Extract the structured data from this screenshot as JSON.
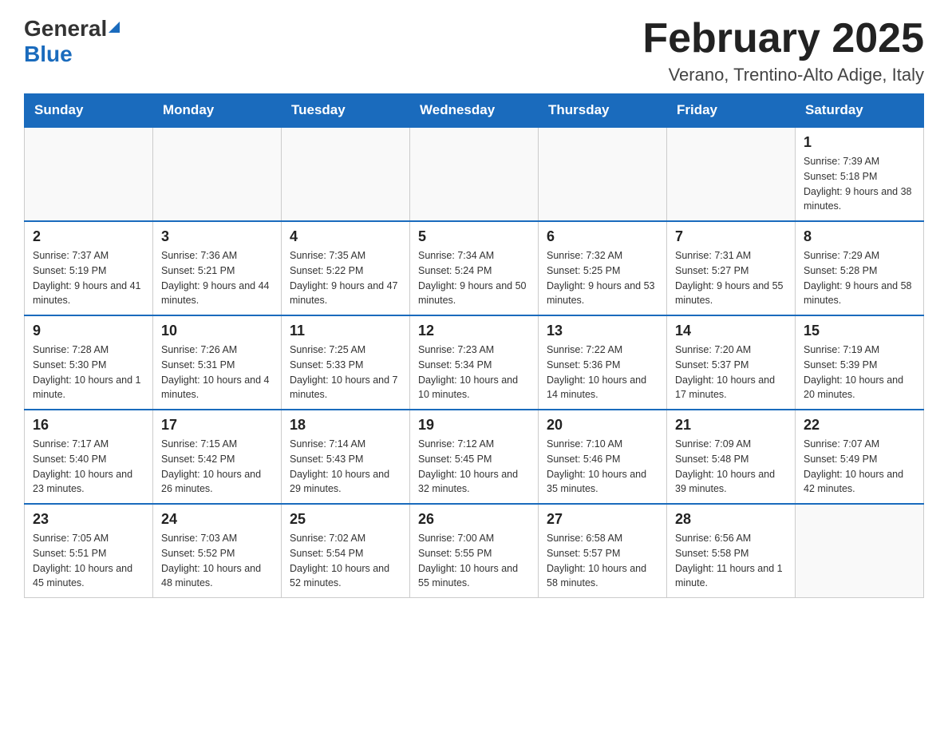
{
  "header": {
    "logo_general": "General",
    "logo_blue": "Blue",
    "month_title": "February 2025",
    "location": "Verano, Trentino-Alto Adige, Italy"
  },
  "days_of_week": [
    "Sunday",
    "Monday",
    "Tuesday",
    "Wednesday",
    "Thursday",
    "Friday",
    "Saturday"
  ],
  "weeks": [
    [
      {
        "day": "",
        "info": ""
      },
      {
        "day": "",
        "info": ""
      },
      {
        "day": "",
        "info": ""
      },
      {
        "day": "",
        "info": ""
      },
      {
        "day": "",
        "info": ""
      },
      {
        "day": "",
        "info": ""
      },
      {
        "day": "1",
        "info": "Sunrise: 7:39 AM\nSunset: 5:18 PM\nDaylight: 9 hours and 38 minutes."
      }
    ],
    [
      {
        "day": "2",
        "info": "Sunrise: 7:37 AM\nSunset: 5:19 PM\nDaylight: 9 hours and 41 minutes."
      },
      {
        "day": "3",
        "info": "Sunrise: 7:36 AM\nSunset: 5:21 PM\nDaylight: 9 hours and 44 minutes."
      },
      {
        "day": "4",
        "info": "Sunrise: 7:35 AM\nSunset: 5:22 PM\nDaylight: 9 hours and 47 minutes."
      },
      {
        "day": "5",
        "info": "Sunrise: 7:34 AM\nSunset: 5:24 PM\nDaylight: 9 hours and 50 minutes."
      },
      {
        "day": "6",
        "info": "Sunrise: 7:32 AM\nSunset: 5:25 PM\nDaylight: 9 hours and 53 minutes."
      },
      {
        "day": "7",
        "info": "Sunrise: 7:31 AM\nSunset: 5:27 PM\nDaylight: 9 hours and 55 minutes."
      },
      {
        "day": "8",
        "info": "Sunrise: 7:29 AM\nSunset: 5:28 PM\nDaylight: 9 hours and 58 minutes."
      }
    ],
    [
      {
        "day": "9",
        "info": "Sunrise: 7:28 AM\nSunset: 5:30 PM\nDaylight: 10 hours and 1 minute."
      },
      {
        "day": "10",
        "info": "Sunrise: 7:26 AM\nSunset: 5:31 PM\nDaylight: 10 hours and 4 minutes."
      },
      {
        "day": "11",
        "info": "Sunrise: 7:25 AM\nSunset: 5:33 PM\nDaylight: 10 hours and 7 minutes."
      },
      {
        "day": "12",
        "info": "Sunrise: 7:23 AM\nSunset: 5:34 PM\nDaylight: 10 hours and 10 minutes."
      },
      {
        "day": "13",
        "info": "Sunrise: 7:22 AM\nSunset: 5:36 PM\nDaylight: 10 hours and 14 minutes."
      },
      {
        "day": "14",
        "info": "Sunrise: 7:20 AM\nSunset: 5:37 PM\nDaylight: 10 hours and 17 minutes."
      },
      {
        "day": "15",
        "info": "Sunrise: 7:19 AM\nSunset: 5:39 PM\nDaylight: 10 hours and 20 minutes."
      }
    ],
    [
      {
        "day": "16",
        "info": "Sunrise: 7:17 AM\nSunset: 5:40 PM\nDaylight: 10 hours and 23 minutes."
      },
      {
        "day": "17",
        "info": "Sunrise: 7:15 AM\nSunset: 5:42 PM\nDaylight: 10 hours and 26 minutes."
      },
      {
        "day": "18",
        "info": "Sunrise: 7:14 AM\nSunset: 5:43 PM\nDaylight: 10 hours and 29 minutes."
      },
      {
        "day": "19",
        "info": "Sunrise: 7:12 AM\nSunset: 5:45 PM\nDaylight: 10 hours and 32 minutes."
      },
      {
        "day": "20",
        "info": "Sunrise: 7:10 AM\nSunset: 5:46 PM\nDaylight: 10 hours and 35 minutes."
      },
      {
        "day": "21",
        "info": "Sunrise: 7:09 AM\nSunset: 5:48 PM\nDaylight: 10 hours and 39 minutes."
      },
      {
        "day": "22",
        "info": "Sunrise: 7:07 AM\nSunset: 5:49 PM\nDaylight: 10 hours and 42 minutes."
      }
    ],
    [
      {
        "day": "23",
        "info": "Sunrise: 7:05 AM\nSunset: 5:51 PM\nDaylight: 10 hours and 45 minutes."
      },
      {
        "day": "24",
        "info": "Sunrise: 7:03 AM\nSunset: 5:52 PM\nDaylight: 10 hours and 48 minutes."
      },
      {
        "day": "25",
        "info": "Sunrise: 7:02 AM\nSunset: 5:54 PM\nDaylight: 10 hours and 52 minutes."
      },
      {
        "day": "26",
        "info": "Sunrise: 7:00 AM\nSunset: 5:55 PM\nDaylight: 10 hours and 55 minutes."
      },
      {
        "day": "27",
        "info": "Sunrise: 6:58 AM\nSunset: 5:57 PM\nDaylight: 10 hours and 58 minutes."
      },
      {
        "day": "28",
        "info": "Sunrise: 6:56 AM\nSunset: 5:58 PM\nDaylight: 11 hours and 1 minute."
      },
      {
        "day": "",
        "info": ""
      }
    ]
  ]
}
